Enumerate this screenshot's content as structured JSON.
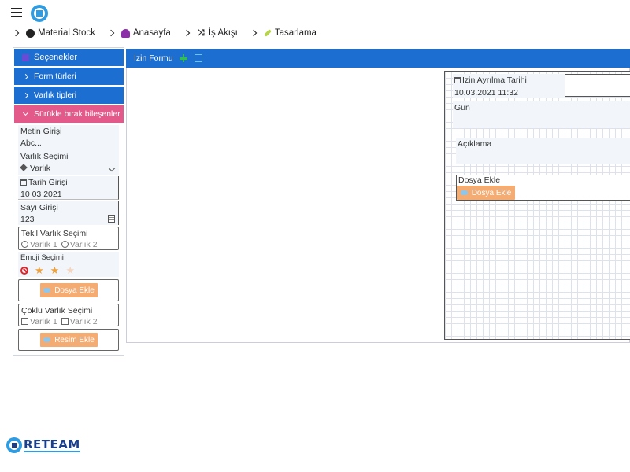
{
  "breadcrumb": {
    "items": [
      {
        "label": "Material Stock",
        "icon": "globe-icon"
      },
      {
        "label": "Anasayfa",
        "icon": "dashboard-icon"
      },
      {
        "label": "İş Akışı",
        "icon": "shuffle-icon"
      },
      {
        "label": "Tasarlama",
        "icon": "brush-icon"
      }
    ]
  },
  "sidebar": {
    "options_title": "Seçenekler",
    "sections": [
      {
        "label": "Form türleri"
      },
      {
        "label": "Varlık tipleri"
      },
      {
        "label": "Sürükle bırak bileşenler"
      }
    ],
    "components": {
      "text_input": {
        "title": "Metin Girişi",
        "value": "Abc..."
      },
      "entity_select": {
        "title": "Varlık Seçimi",
        "value": "Varlık"
      },
      "date_input": {
        "title": "Tarih Girişi",
        "value": "10 03 2021"
      },
      "number_input": {
        "title": "Sayı Girişi",
        "value": "123"
      },
      "single_entity": {
        "title": "Tekil Varlık Seçimi",
        "option1": "Varlık 1",
        "option2": "Varlık 2"
      },
      "emoji": {
        "title": "Emoji Seçimi",
        "rating": 2,
        "max": 3
      },
      "file_button": "Dosya Ekle",
      "multi_entity": {
        "title": "Çoklu Varlık Seçimi",
        "option1": "Varlık 1",
        "option2": "Varlık 2"
      },
      "image_button": "Resim Ekle"
    }
  },
  "form": {
    "title": "İzin Formu",
    "fields": {
      "leave_date": {
        "title": "İzin Ayrılma Tarihi",
        "value": "10.03.2021 11:32"
      },
      "days": {
        "title": "Gün"
      },
      "description": {
        "title": "Açıklama"
      },
      "file": {
        "title": "Dosya Ekle",
        "button": "Dosya Ekle"
      }
    }
  },
  "footer": {
    "brand": "RETEAM"
  },
  "colors": {
    "primary": "#1c6fd0",
    "pink": "#e35a8a",
    "orange": "#f5ac72"
  }
}
